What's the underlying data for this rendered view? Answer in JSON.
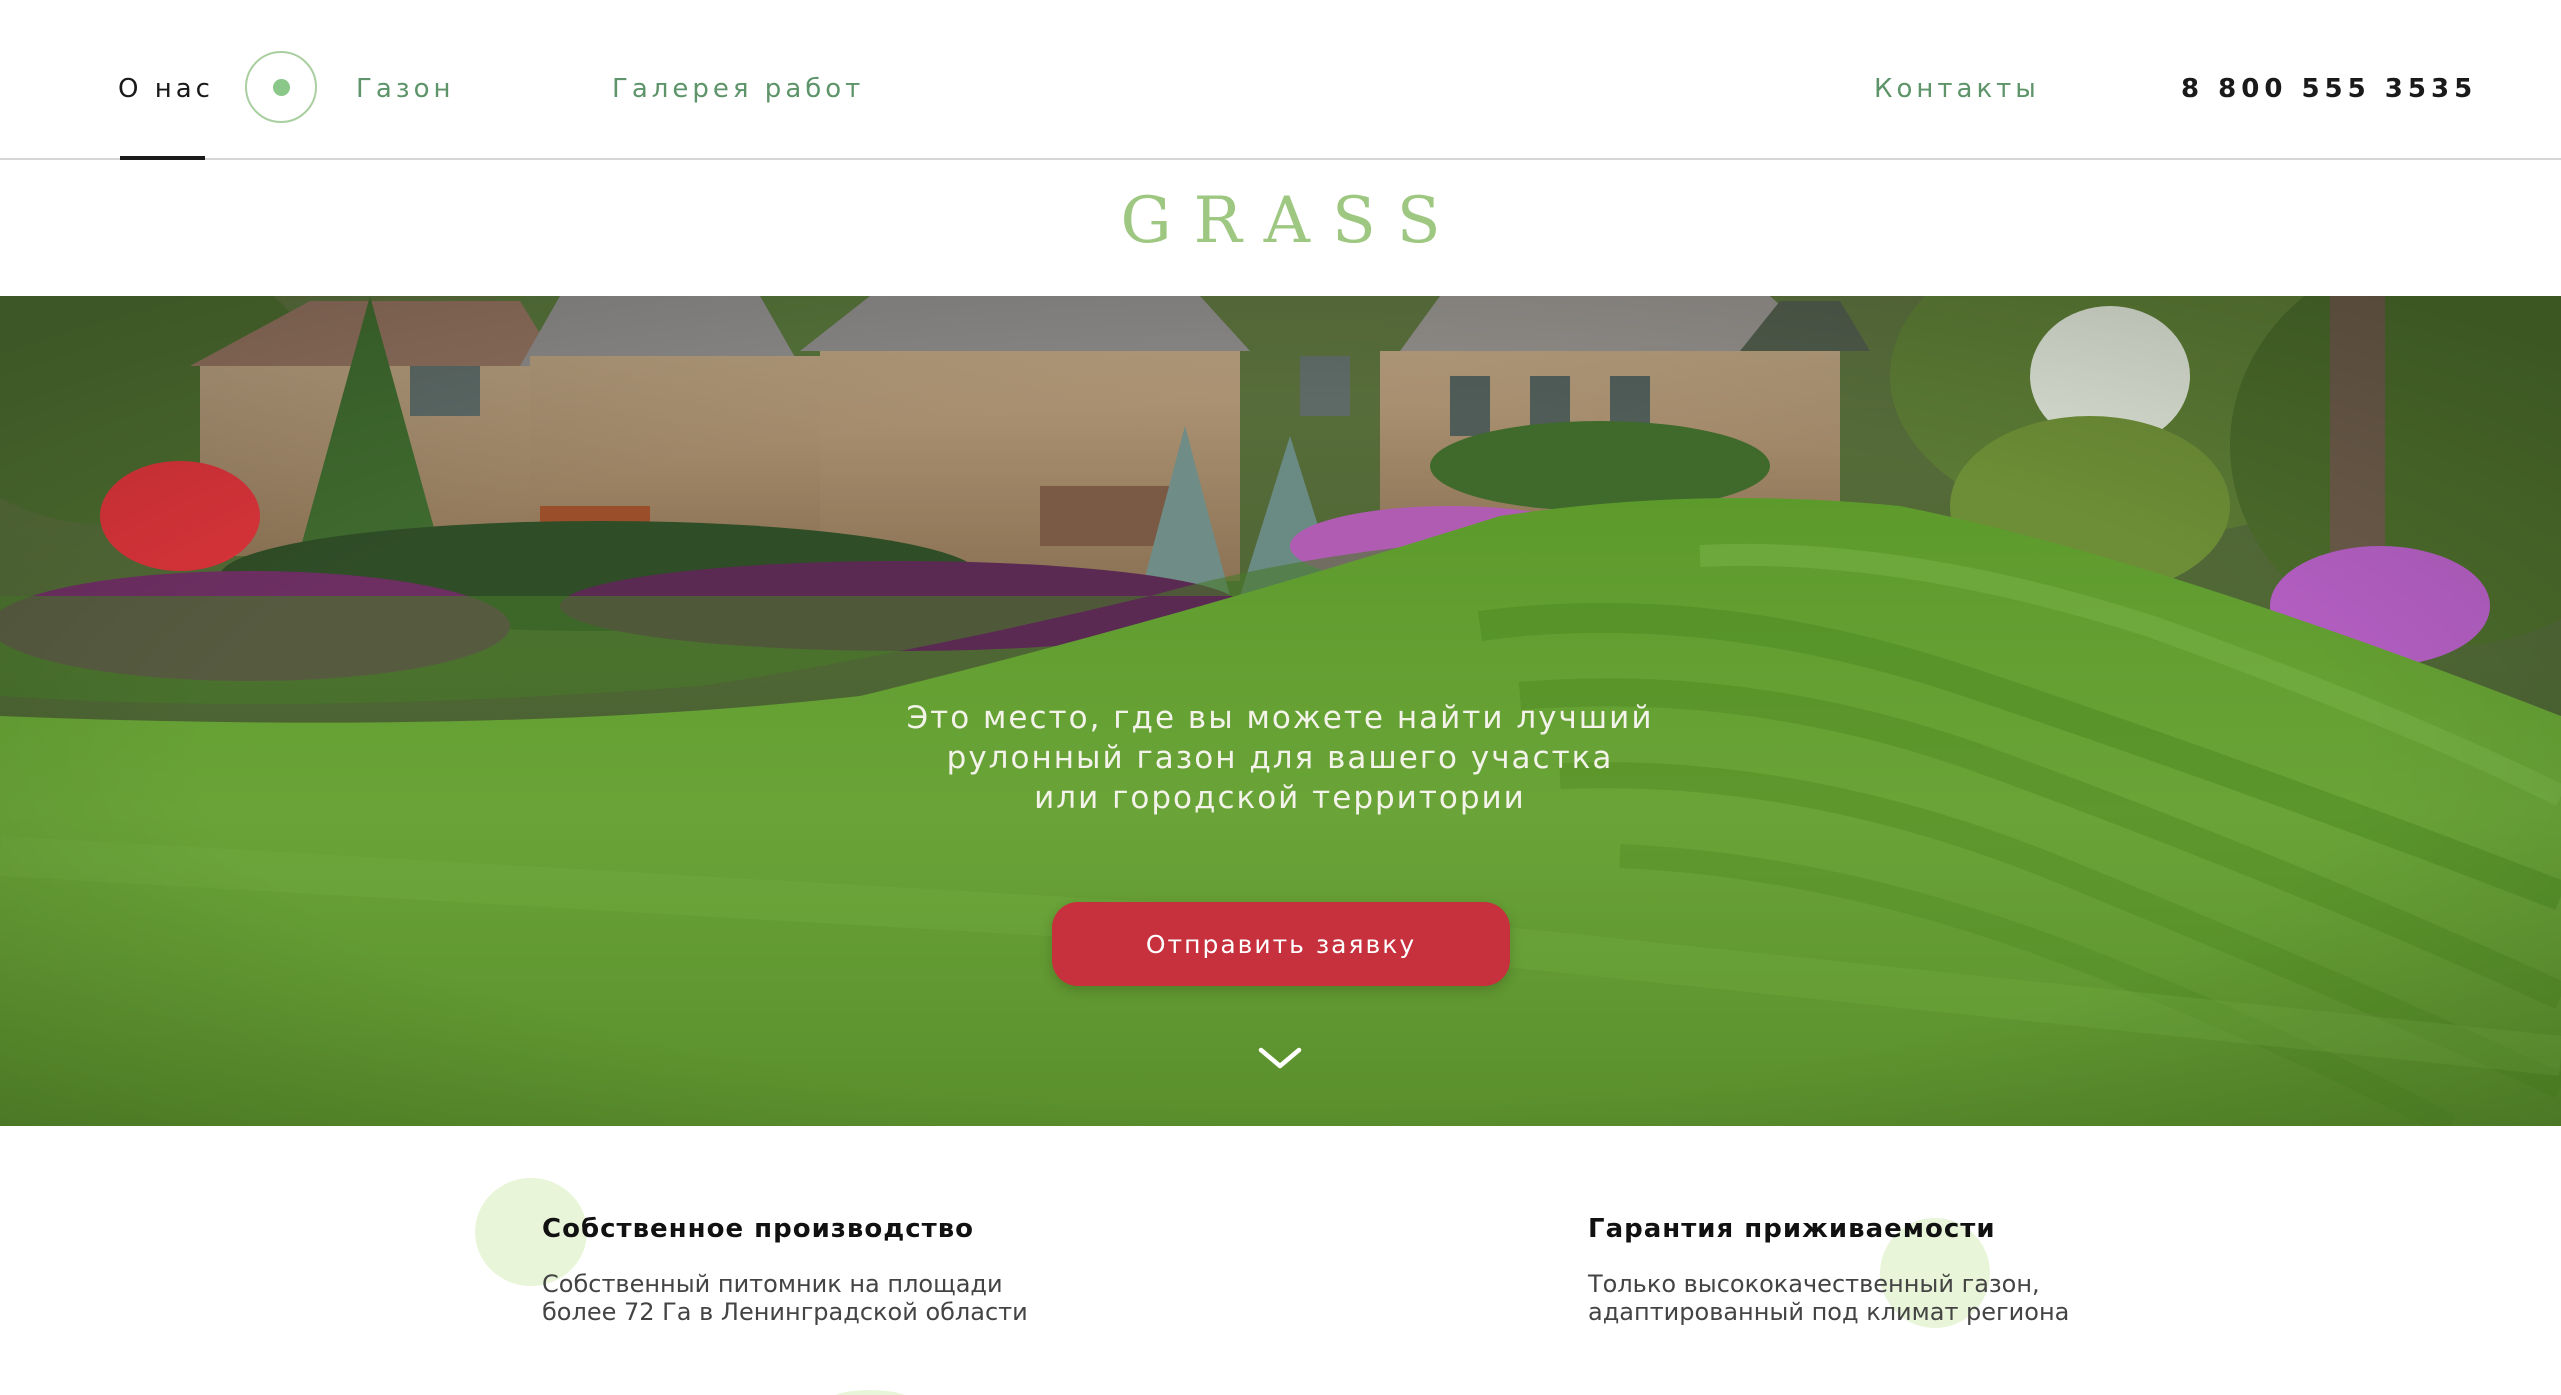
{
  "header": {
    "nav": [
      {
        "label": "О нас",
        "active": true
      },
      {
        "label": "Газон",
        "active": false
      },
      {
        "label": "Галерея работ",
        "active": false
      }
    ],
    "contacts_label": "Контакты",
    "phone": "8 800 555 3535"
  },
  "logo": "GRASS",
  "hero": {
    "text_lines": [
      "Это место, где вы можете найти лучший",
      "рулонный газон для вашего участка",
      "или городской территории"
    ],
    "cta_label": "Отправить заявку",
    "scroll_icon": "chevron-down-icon"
  },
  "features": [
    {
      "title": "Собственное производство",
      "desc_lines": [
        "Собственный питомник на площади",
        "более 72 Га в Ленинградской области"
      ]
    },
    {
      "title": "Гарантия приживаемости",
      "desc_lines": [
        "Только высококачественный газон,",
        "адаптированный под климат региона"
      ]
    }
  ],
  "colors": {
    "accent_green": "#5e9469",
    "logo_green": "#9ec882",
    "cta_red": "#c7303d",
    "blob_green": "#e8f5d8"
  }
}
